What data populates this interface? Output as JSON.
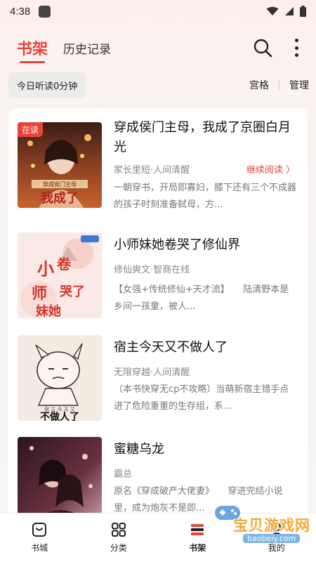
{
  "status_bar": {
    "time": "4:38"
  },
  "header": {
    "tab_active": "书架",
    "tab_inactive": "历史记录"
  },
  "sub_bar": {
    "listen_today": "今日听读0分钟",
    "grid_label": "宫格",
    "manage_label": "管理"
  },
  "books": [
    {
      "title": "穿成侯门主母，我成了京圈白月光",
      "badge": "在读",
      "meta": "家长里短·人间清醒",
      "continue_label": "继续阅读 〉",
      "desc": "一朝穿书，开局即寡妇，膝下还有三个不成器的孩子时刻准备弑母，方...",
      "cover_text": "穿成侯门主母 我成了"
    },
    {
      "title": "小师妹她卷哭了修仙界",
      "meta": "修仙爽文·智商在线",
      "desc": "【女强+传统修仙+天才流】　　陆清野本是乡间一孩童，被人...",
      "cover_text": "小师妹她卷哭了修仙界"
    },
    {
      "title": "宿主今天又不做人了",
      "meta": "无限穿越·人间清醒",
      "desc": "（本书快穿无cp不攻略）当萌新宿主错手点进了危险重重的生存组，系...",
      "cover_text": "宿主今天又 不做人了"
    },
    {
      "title": "蜜糖乌龙",
      "meta": "霸总",
      "desc": "原名《穿成破产大佬妻》　　穿进完结小说里，成为炮灰不是即...",
      "cover_text": ""
    }
  ],
  "bottom_nav": [
    {
      "label": "书城",
      "icon": "store-icon"
    },
    {
      "label": "分类",
      "icon": "grid-icon"
    },
    {
      "label": "书架",
      "icon": "bookshelf-icon"
    },
    {
      "label": "我的",
      "icon": "profile-icon"
    }
  ],
  "watermark": {
    "text": "宝贝游戏网",
    "url": "baobeiy.com"
  },
  "colors": {
    "accent": "#e84438",
    "watermark": "#f4a93a"
  }
}
